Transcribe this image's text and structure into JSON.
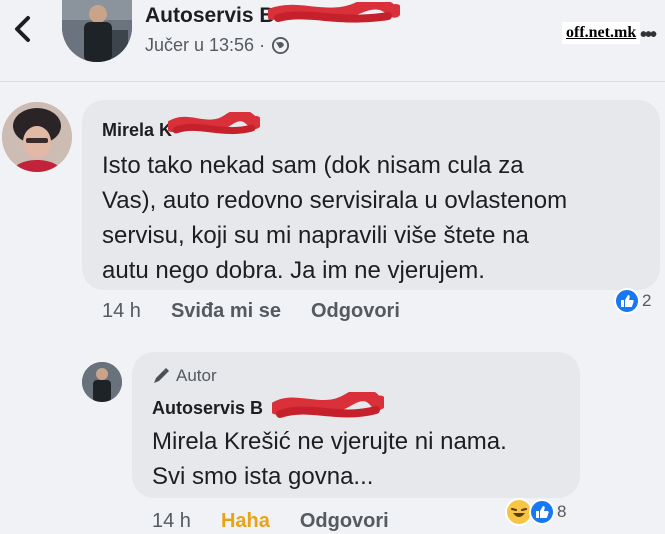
{
  "header": {
    "author": "Autoservis B",
    "timestamp": "Jučer u 13:56 ·",
    "watermark": "off.net.mk"
  },
  "comments": [
    {
      "author": "Mirela K",
      "lines": [
        "Isto tako nekad sam (dok nisam cula za",
        "Vas), auto redovno servisirala u ovlastenom",
        "servisu, koji su mi napravili više štete na",
        "autu nego dobra. Ja im ne vjerujem."
      ],
      "time": "14 h",
      "like_label": "Sviđa mi se",
      "reply_label": "Odgovori",
      "reaction_count": "2"
    },
    {
      "badge": "Autor",
      "author": "Autoservis B",
      "lines": [
        "Mirela Krešić ne vjerujte ni nama.",
        "Svi smo ista govna..."
      ],
      "time": "14 h",
      "like_label": "Haha",
      "reply_label": "Odgovori",
      "reaction_count": "8"
    }
  ],
  "colors": {
    "background": "#f0f2f5",
    "bubble": "#e6e8eb",
    "like_blue": "#1877f2",
    "haha_yellow": "#e8a317",
    "redaction": "#d9303a"
  }
}
